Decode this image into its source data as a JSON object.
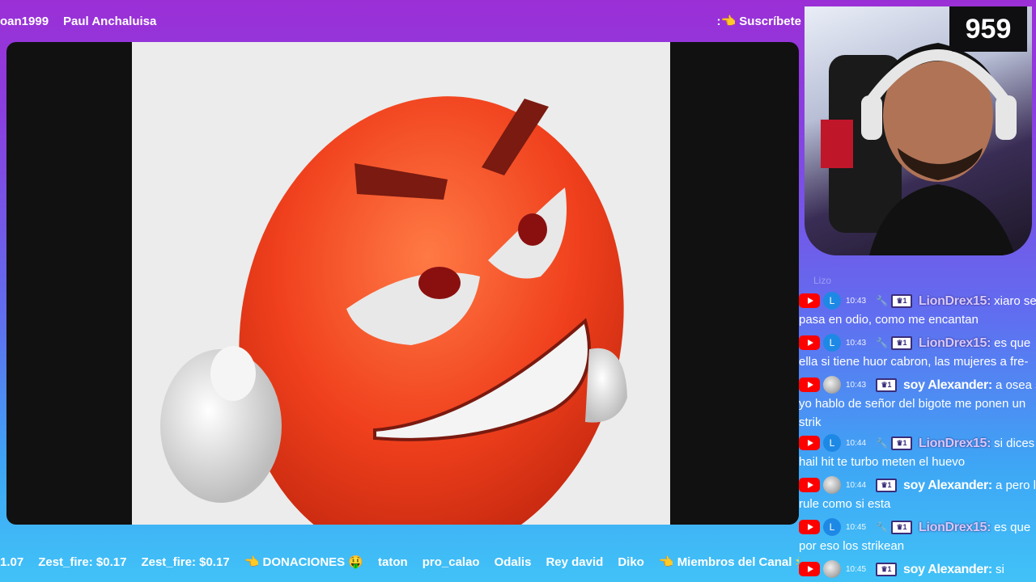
{
  "top_ticker": {
    "names": [
      "oan1999",
      "Paul Anchaluisa"
    ],
    "subscribe_label": ":👈 Suscríbete"
  },
  "webcam": {
    "viewer_count": "959"
  },
  "chat": {
    "faded_header": "Lizo",
    "messages": [
      {
        "avatar_type": "letter",
        "avatar": "L",
        "time": "10:43",
        "user": "LionDrex15:",
        "user_style": "purple",
        "inline": "xiaro se",
        "body": "pasa en odio, como me encantan"
      },
      {
        "avatar_type": "letter",
        "avatar": "L",
        "time": "10:43",
        "user": "LionDrex15:",
        "user_style": "purple",
        "inline": "es que",
        "body": "ella si tiene huor cabron, las mujeres a fre-"
      },
      {
        "avatar_type": "img",
        "avatar": "",
        "time": "10:43",
        "user": "soy Alexander:",
        "user_style": "white",
        "inline": "a osea si",
        "body": "yo hablo de señor del bigote me ponen un strik"
      },
      {
        "avatar_type": "letter",
        "avatar": "L",
        "time": "10:44",
        "user": "LionDrex15:",
        "user_style": "purple",
        "inline": "si dices",
        "body": "hail hit te turbo meten el huevo"
      },
      {
        "avatar_type": "img",
        "avatar": "",
        "time": "10:44",
        "user": "soy Alexander:",
        "user_style": "white",
        "inline": "a pero la",
        "body": "rule como si esta"
      },
      {
        "avatar_type": "letter",
        "avatar": "L",
        "time": "10:45",
        "user": "LionDrex15:",
        "user_style": "purple",
        "inline": "es que",
        "body": "por eso los strikean"
      },
      {
        "avatar_type": "img",
        "avatar": "",
        "time": "10:45",
        "user": "soy Alexander:",
        "user_style": "white",
        "inline": "si",
        "body": ""
      }
    ]
  },
  "bottom_ticker": {
    "items": [
      "1.07",
      "Zest_fire: $0.17",
      "Zest_fire: $0.17",
      "👈 DONACIONES 🤑",
      "taton",
      "pro_calao",
      "Odalis",
      "Rey david",
      "Diko",
      "👈 Miembros del Canal 🌟"
    ]
  },
  "colors": {
    "accent_purple": "#9b2fd6",
    "accent_blue": "#41c2f7",
    "youtube_red": "#ff0000"
  }
}
